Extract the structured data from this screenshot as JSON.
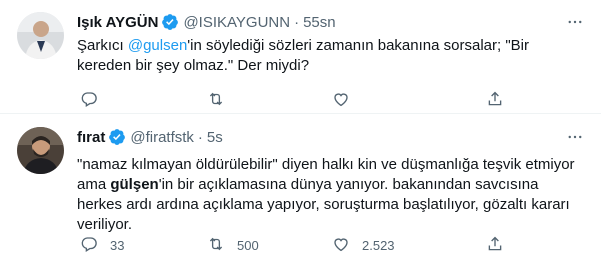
{
  "tweets": [
    {
      "name": "Işık AYGÜN",
      "handle": "@ISIKAYGUNN",
      "separator": "·",
      "time": "55sn",
      "text_parts": [
        "Şarkıcı ",
        "@gulsen",
        "'in söylediği sözleri zamanın bakanına sorsalar; \"Bir kereden bir şey olmaz.\" Der miydi?"
      ],
      "reply_count": "",
      "retweet_count": "",
      "like_count": ""
    },
    {
      "name": "fırat",
      "handle": "@firatfstk",
      "separator": "·",
      "time": "5s",
      "text_parts": [
        "\"namaz kılmayan öldürülebilir\" diyen halkı kin ve düşmanlığa teşvik etmiyor ama ",
        "gülşen",
        "'in bir açıklamasına dünya yanıyor. bakanından savcısına herkes ardı ardına açıklama yapıyor, soruşturma başlatılıyor, gözaltı kararı veriliyor."
      ],
      "reply_count": "33",
      "retweet_count": "500",
      "like_count": "2.523"
    }
  ],
  "colors": {
    "accent": "#1d9bf0",
    "muted": "#536471",
    "text": "#0f1419",
    "divider": "#eff3f4"
  },
  "icons": [
    "verified-badge-icon",
    "more-icon",
    "reply-icon",
    "retweet-icon",
    "like-icon",
    "share-icon"
  ]
}
